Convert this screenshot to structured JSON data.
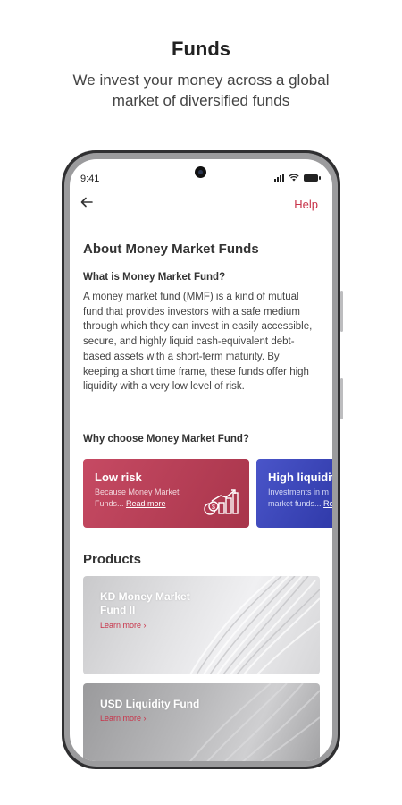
{
  "promo": {
    "title": "Funds",
    "subtitle": "We invest your money across a global market of diversified funds"
  },
  "status_bar": {
    "time": "9:41"
  },
  "nav": {
    "back_icon": "arrow-left-icon",
    "help_label": "Help"
  },
  "about": {
    "title": "About Money Market Funds",
    "question": "What is Money Market Fund?",
    "description": "A money market fund (MMF) is a kind of mutual fund that provides investors with a safe medium through which they can invest in easily accessible, secure, and highly liquid cash-equivalent debt-based assets with a short-term maturity. By keeping a short time frame, these funds offer high liquidity with a very low level of risk."
  },
  "why": {
    "title": "Why choose Money Market Fund?",
    "cards": [
      {
        "title": "Low risk",
        "desc_line1": "Because Money Market",
        "desc_line2": "Funds...",
        "link": "Read more",
        "icon": "chart-coins-icon",
        "color": "#b83c54"
      },
      {
        "title": "High liquidity",
        "desc_line1": "Investments in m",
        "desc_line2": "market funds...",
        "link": "Re",
        "icon": "",
        "color": "#3a44b8"
      }
    ]
  },
  "products": {
    "title": "Products",
    "items": [
      {
        "name": "KD Money Market Fund II",
        "link": "Learn more"
      },
      {
        "name": "USD Liquidity Fund",
        "link": "Learn more"
      }
    ]
  },
  "colors": {
    "accent": "#c8344a",
    "card_low_risk": "#b83c54",
    "card_high_liquidity": "#3a44b8"
  }
}
